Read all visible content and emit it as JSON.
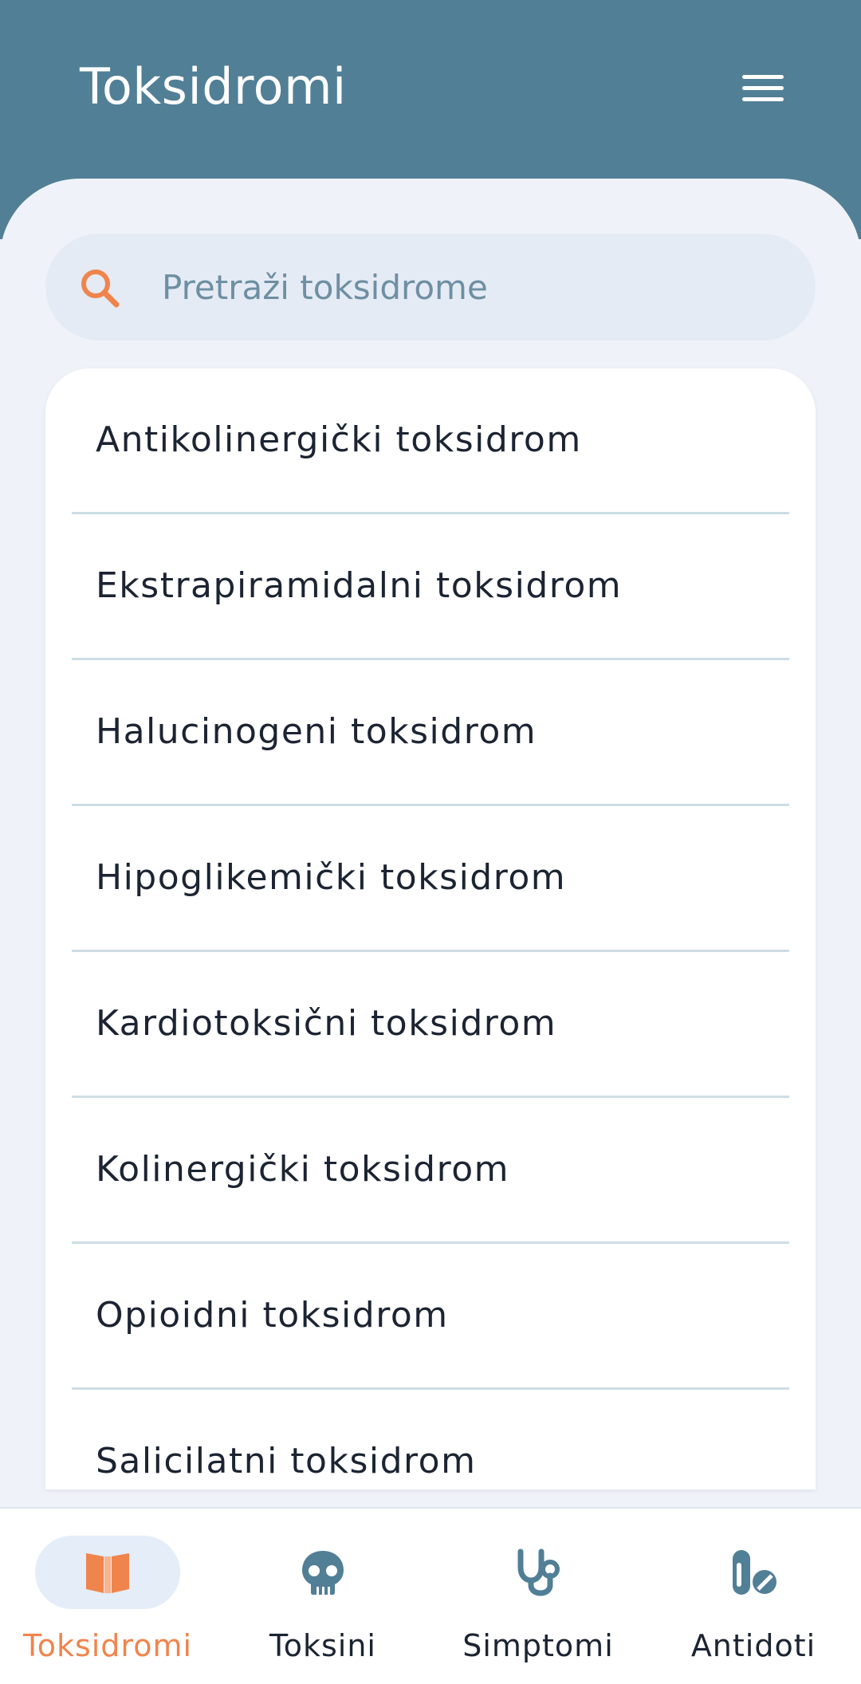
{
  "colors": {
    "header": "#517f96",
    "accent": "#f0844d",
    "icon": "#517f96",
    "background": "#eff3f9"
  },
  "header": {
    "title": "Toksidromi",
    "menu_icon": "hamburger-menu-icon"
  },
  "search": {
    "placeholder": "Pretraži toksidrome",
    "value": "",
    "icon": "search-icon"
  },
  "list": {
    "items": [
      {
        "label": "Antikolinergički toksidrom"
      },
      {
        "label": "Ekstrapiramidalni toksidrom"
      },
      {
        "label": "Halucinogeni toksidrom"
      },
      {
        "label": "Hipoglikemički toksidrom"
      },
      {
        "label": "Kardiotoksični toksidrom"
      },
      {
        "label": "Kolinergički toksidrom"
      },
      {
        "label": "Opioidni toksidrom"
      },
      {
        "label": "Salicilatni toksidrom"
      }
    ]
  },
  "bottom_nav": {
    "items": [
      {
        "label": "Toksidromi",
        "icon": "open-book-icon",
        "active": true
      },
      {
        "label": "Toksini",
        "icon": "skull-icon",
        "active": false
      },
      {
        "label": "Simptomi",
        "icon": "stethoscope-icon",
        "active": false
      },
      {
        "label": "Antidoti",
        "icon": "pills-icon",
        "active": false
      }
    ]
  }
}
